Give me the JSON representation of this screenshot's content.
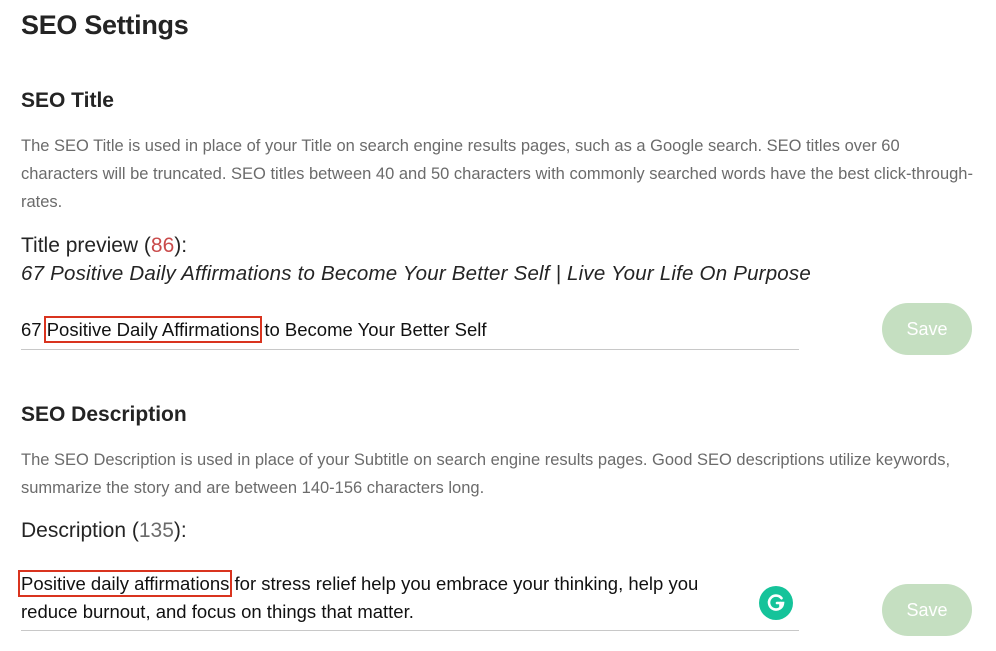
{
  "page": {
    "title": "SEO Settings"
  },
  "seo_title": {
    "heading": "SEO Title",
    "help": "The SEO Title is used in place of your Title on search engine results pages, such as a Google search. SEO titles over 60 characters will be truncated. SEO titles between 40 and 50 characters with commonly searched words have the best click-through-rates.",
    "preview_label": "Title preview",
    "preview_count": "86",
    "preview_text": "67 Positive Daily Affirmations to Become Your Better Self | Live Your Life On Purpose",
    "input_prefix": "67 ",
    "input_highlight": "Positive Daily Affirmations",
    "input_suffix": " to Become Your Better Self",
    "save_label": "Save"
  },
  "seo_description": {
    "heading": "SEO Description",
    "help": "The SEO Description is used in place of your Subtitle on search engine results pages. Good SEO descriptions utilize keywords, summarize the story and are between 140-156 characters long.",
    "label": "Description",
    "count": "135",
    "input_highlight": "Positive daily affirmations",
    "input_rest": " for stress relief help you embrace your thinking, help you reduce burnout, and focus on things that matter.",
    "save_label": "Save"
  },
  "colors": {
    "highlight_box": "#d9341f",
    "save_button": "#c5dfc1",
    "over_limit_count": "#c94a4a",
    "grammarly": "#15c39a"
  },
  "icons": {
    "grammarly": "grammarly-icon"
  }
}
